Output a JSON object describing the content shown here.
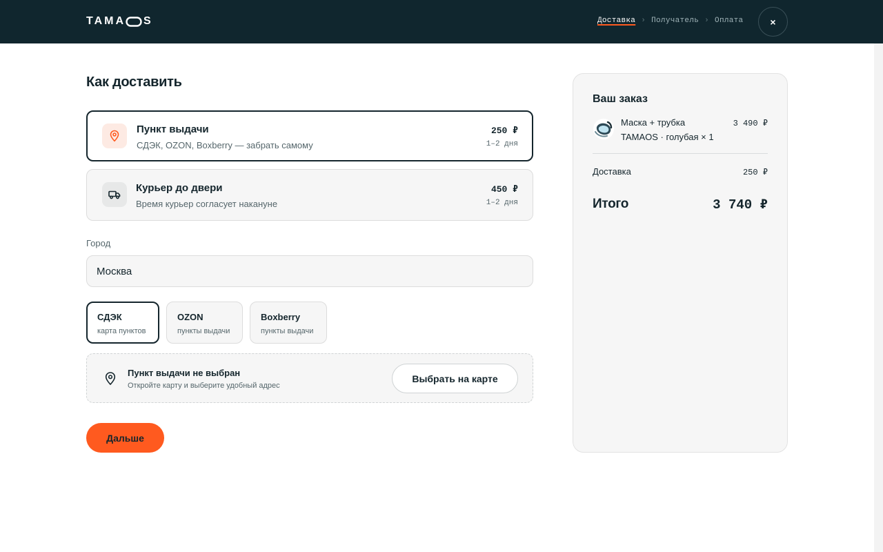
{
  "header": {
    "logo_main": "TAMA",
    "logo_tail": "S",
    "steps": [
      "Доставка",
      "Получатель",
      "Оплата"
    ],
    "step_separator": "›",
    "close_label": "×"
  },
  "main": {
    "title": "Как доставить",
    "delivery_options": [
      {
        "title": "Пункт выдачи",
        "subtitle": "СДЭК, OZON, Boxberry — забрать самому",
        "price": "250 ₽",
        "eta": "1–2 дня",
        "icon": "location-pin-icon",
        "selected": true
      },
      {
        "title": "Курьер до двери",
        "subtitle": "Время курьер согласует накануне",
        "price": "450 ₽",
        "eta": "1–2 дня",
        "icon": "truck-icon",
        "selected": false
      }
    ],
    "city": {
      "label": "Город",
      "value": "Москва"
    },
    "carriers": [
      {
        "title": "СДЭК",
        "subtitle": "карта пунктов",
        "selected": true
      },
      {
        "title": "OZON",
        "subtitle": "пункты выдачи",
        "selected": false
      },
      {
        "title": "Boxberry",
        "subtitle": "пункты выдачи",
        "selected": false
      }
    ],
    "pickup": {
      "title": "Пункт выдачи не выбран",
      "subtitle": "Откройте карту и выберите удобный адрес",
      "button": "Выбрать на карте"
    },
    "next_button": "Дальше"
  },
  "summary": {
    "title": "Ваш заказ",
    "item": {
      "name": "Маска + трубка",
      "variant": "TAMAOS · голубая × 1",
      "price": "3 490 ₽"
    },
    "delivery_label": "Доставка",
    "delivery_value": "250 ₽",
    "total_label": "Итого",
    "total_value": "3 740 ₽"
  },
  "colors": {
    "header_bg": "#10262e",
    "accent": "#ff5a1f",
    "text": "#14252c",
    "muted": "#55666b",
    "card_bg": "#f6f6f6"
  }
}
